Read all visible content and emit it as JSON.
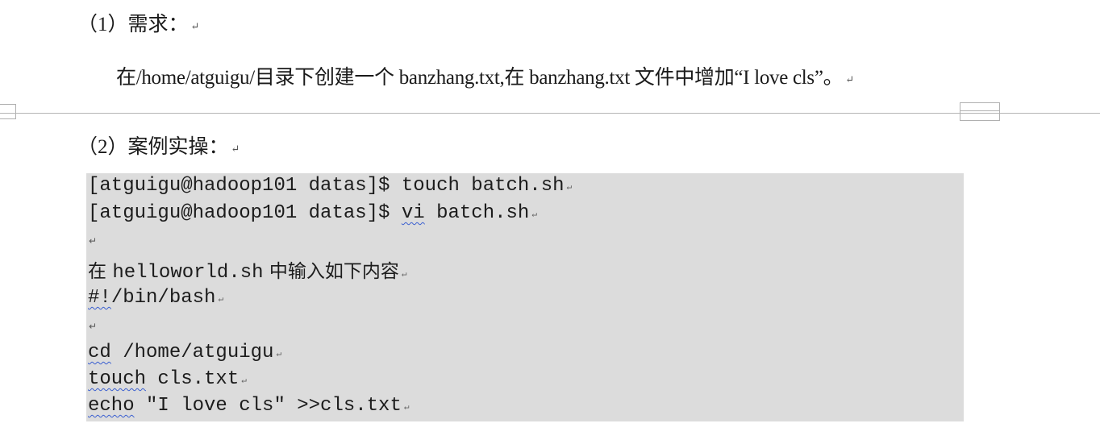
{
  "section1": {
    "heading": "（1）需求：",
    "paragraph": "在/home/atguigu/目录下创建一个 banzhang.txt,在 banzhang.txt 文件中增加“I love cls”。"
  },
  "section2": {
    "heading": "（2）案例实操："
  },
  "paragraph_mark": "↵",
  "code": {
    "line1_prompt": "[atguigu@hadoop101 datas]$ ",
    "line1_cmd": "touch batch.sh",
    "line2_prompt": "[atguigu@hadoop101 datas]$ ",
    "line2_vi": "vi",
    "line2_rest": " batch.sh",
    "line4_a": "在 ",
    "line4_b": "helloworld.sh",
    "line4_c": " 中输入如下内容",
    "line5_shebang": "#!",
    "line5_rest": "/bin/bash",
    "line7_cd": "cd",
    "line7_rest": " /home/atguigu",
    "line8_touch": "touch",
    "line8_rest": " cls.txt",
    "line9_echo": "echo",
    "line9_rest": " \"I love cls\" >>cls.txt"
  }
}
